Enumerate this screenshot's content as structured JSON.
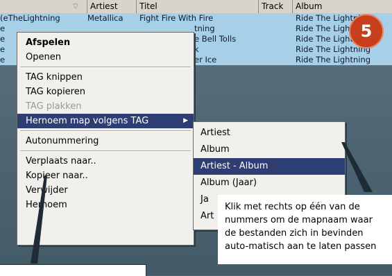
{
  "columns": {
    "col0": "",
    "artiest": "Artiest",
    "titel": "Titel",
    "track": "Track",
    "album": "Album"
  },
  "rows": [
    {
      "file": "eTheLightning)",
      "artist": "Metallica",
      "title": "Fight Fire With Fire",
      "album": "Ride The Lightning"
    },
    {
      "file": "e",
      "artist": "",
      "title": "tning",
      "album": "Ride The Lightning"
    },
    {
      "file": "e",
      "artist": "",
      "title": "e Bell Tolls",
      "album": "Ride The Lightning"
    },
    {
      "file": "e",
      "artist": "",
      "title": "k",
      "album": "Ride The Lightning"
    },
    {
      "file": "e",
      "artist": "",
      "title": "er Ice",
      "album": "Ride The Lightning"
    }
  ],
  "context_menu": {
    "items": [
      {
        "label": "Afspelen",
        "style": "bold"
      },
      {
        "label": "Openen",
        "style": "normal"
      },
      {
        "label": "TAG knippen",
        "style": "normal"
      },
      {
        "label": "TAG kopieren",
        "style": "normal"
      },
      {
        "label": "TAG plakken",
        "style": "disabled"
      },
      {
        "label": "Hernoem map volgens TAG",
        "style": "selected"
      },
      {
        "label": "Autonummering",
        "style": "normal"
      },
      {
        "label": "Verplaats naar..",
        "style": "normal"
      },
      {
        "label": "Kopieer naar..",
        "style": "normal"
      },
      {
        "label": "Verwijder",
        "style": "normal"
      },
      {
        "label": "Hernoem",
        "style": "normal"
      }
    ]
  },
  "submenu": {
    "items": [
      {
        "label": "Artiest"
      },
      {
        "label": "Album"
      },
      {
        "label": "Artiest - Album"
      },
      {
        "label": "Album (Jaar)"
      },
      {
        "label": "Ja"
      },
      {
        "label": "Art"
      }
    ]
  },
  "callout": {
    "text": "Klik met rechts op één van de nummers om de mapnaam waar de bestanden zich in bevinden auto-matisch aan te laten passen"
  },
  "badge": "5",
  "colors": {
    "selection": "#2e3e72",
    "row_highlight": "#a7cfe8",
    "badge": "#c73e1d"
  }
}
